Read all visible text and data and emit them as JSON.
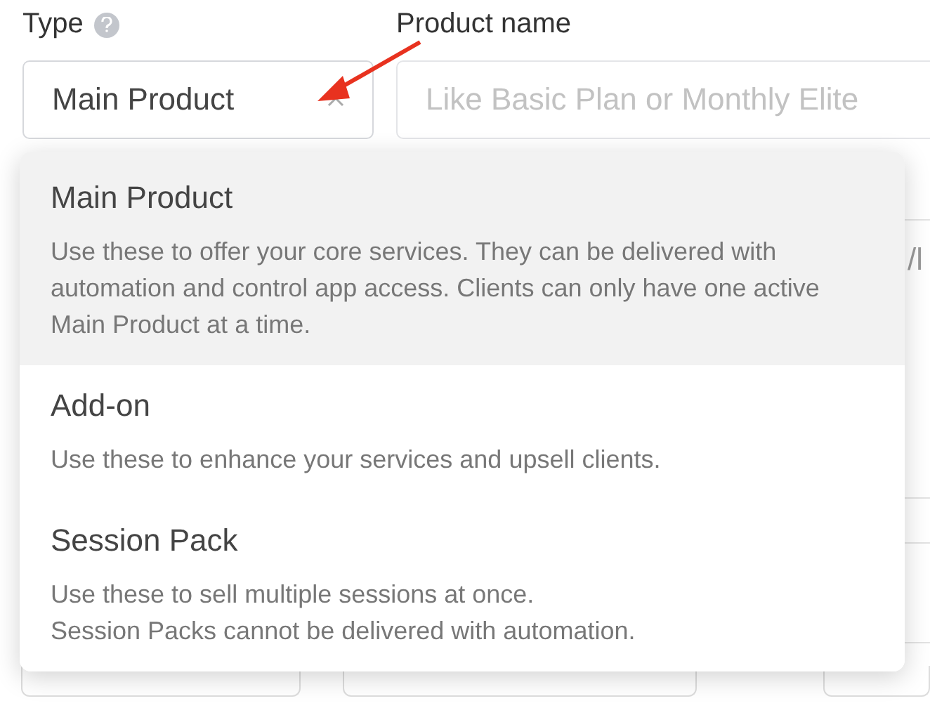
{
  "type_field": {
    "label": "Type",
    "value": "Main Product"
  },
  "name_field": {
    "label": "Product name",
    "placeholder": "Like Basic Plan or Monthly Elite"
  },
  "background_fragment": "/l",
  "dropdown": {
    "options": [
      {
        "title": "Main Product",
        "description": "Use these to offer your core services. They can be delivered with automation and control app access. Clients can only have one active Main Product at a time.",
        "selected": true
      },
      {
        "title": "Add-on",
        "description": "Use these to enhance your services and upsell clients.",
        "selected": false
      },
      {
        "title": "Session Pack",
        "description": "Use these to sell multiple sessions at once.\nSession Packs cannot be delivered with automation.",
        "selected": false
      }
    ]
  }
}
